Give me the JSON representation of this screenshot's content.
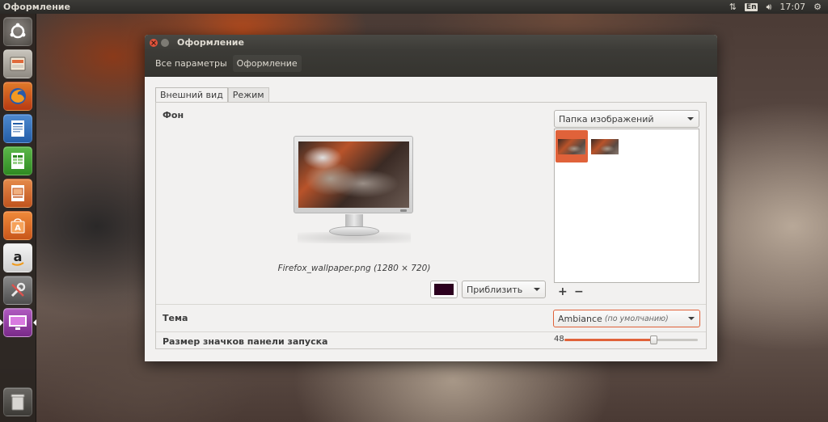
{
  "top_panel": {
    "app_title": "Оформление",
    "keyboard_layout": "En",
    "clock": "17:07"
  },
  "launcher": {
    "items": [
      {
        "name": "dash-home",
        "icon": "ubuntu-logo-icon"
      },
      {
        "name": "files",
        "icon": "file-cabinet-icon"
      },
      {
        "name": "firefox",
        "icon": "firefox-icon"
      },
      {
        "name": "writer",
        "icon": "writer-document-icon"
      },
      {
        "name": "calc",
        "icon": "calc-spreadsheet-icon"
      },
      {
        "name": "impress",
        "icon": "impress-presentation-icon"
      },
      {
        "name": "software-center",
        "icon": "shopping-bag-icon"
      },
      {
        "name": "amazon",
        "icon": "amazon-icon"
      },
      {
        "name": "system-settings",
        "icon": "wrench-screwdriver-icon"
      },
      {
        "name": "appearance",
        "icon": "monitor-display-icon"
      }
    ],
    "trash_icon": "trash-icon"
  },
  "window": {
    "title": "Оформление",
    "breadcrumb": {
      "all_settings": "Все параметры",
      "current": "Оформление"
    },
    "tabs": [
      {
        "label": "Внешний вид",
        "active": true
      },
      {
        "label": "Режим",
        "active": false
      }
    ],
    "background": {
      "label": "Фон",
      "wallpaper_caption": "Firefox_wallpaper.png (1280 × 720)",
      "folder_select": "Папка изображений",
      "zoom_select": "Приблизить",
      "color": "#2c001e",
      "add_label": "+",
      "remove_label": "−"
    },
    "theme": {
      "label": "Тема",
      "value": "Ambiance",
      "value_note": "(по умолчанию)"
    },
    "launcher_icon_size": {
      "label": "Размер значков панели запуска",
      "value": "48",
      "min": 16,
      "max": 64
    },
    "accent_color": "#e0623a"
  }
}
